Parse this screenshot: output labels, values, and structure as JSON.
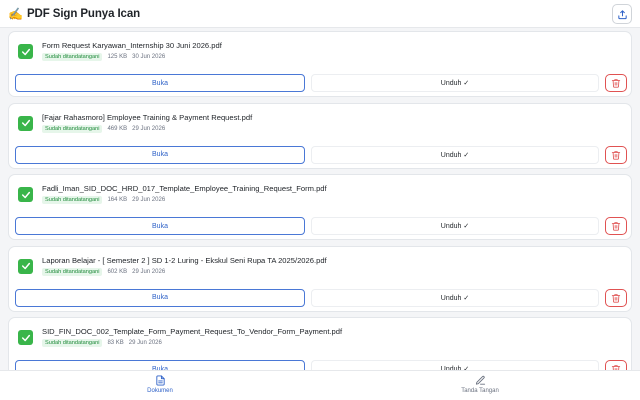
{
  "header": {
    "logo_glyph": "✍️",
    "title": "PDF Sign Punya Ican",
    "upload_icon": "upload-icon"
  },
  "documents": [
    {
      "name": "Form Request Karyawan_Internship 30 Juni 2026.pdf",
      "status": "Sudah ditandatangani",
      "size": "125 KB",
      "date": "30 Jun 2026"
    },
    {
      "name": "[Fajar Rahasmoro] Employee Training & Payment Request.pdf",
      "status": "Sudah ditandatangani",
      "size": "469 KB",
      "date": "29 Jun 2026"
    },
    {
      "name": "Fadli_Iman_SID_DOC_HRD_017_Template_Employee_Training_Request_Form.pdf",
      "status": "Sudah ditandatangani",
      "size": "164 KB",
      "date": "29 Jun 2026"
    },
    {
      "name": "Laporan Belajar - [ Semester 2 ] SD 1-2 Luring - Ekskul Seni Rupa TA 2025/2026.pdf",
      "status": "Sudah ditandatangani",
      "size": "602 KB",
      "date": "29 Jun 2026"
    },
    {
      "name": "SID_FIN_DOC_002_Template_Form_Payment_Request_To_Vendor_Form_Payment.pdf",
      "status": "Sudah ditandatangani",
      "size": "83 KB",
      "date": "29 Jun 2026"
    }
  ],
  "actions": {
    "open_label": "Buka",
    "download_label": "Unduh ✓"
  },
  "bottom_nav": {
    "documents_label": "Dokumen",
    "signature_label": "Tanda Tangan"
  },
  "colors": {
    "accent": "#2f62c8",
    "success": "#39b54a",
    "danger": "#e05252"
  }
}
